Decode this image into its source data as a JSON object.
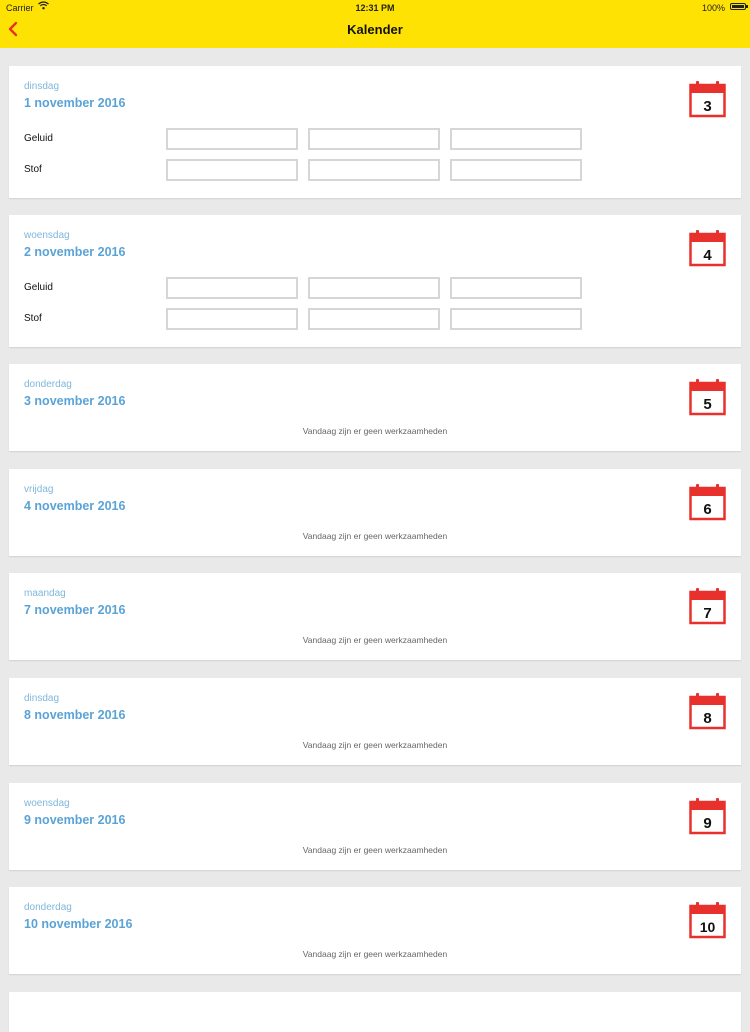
{
  "status_bar": {
    "carrier": "Carrier",
    "time": "12:31 PM",
    "battery": "100%"
  },
  "nav": {
    "title": "Kalender",
    "back": "back"
  },
  "rows": {
    "sound": "Geluid",
    "dust": "Stof"
  },
  "no_work": "Vandaag zijn er geen werkzaamheden",
  "colors": {
    "header_bg": "#fde204",
    "accent_red": "#e8302c",
    "date_blue": "#5aa3d6",
    "weekday_blue": "#7fb7dc"
  },
  "icons": {
    "back": "chevron-left-icon",
    "calendar": "calendar-icon",
    "wifi": "wifi-icon",
    "battery": "battery-icon"
  },
  "days": [
    {
      "weekday": "dinsdag",
      "date": "1 november 2016",
      "icon_day": "3",
      "has_fields": true
    },
    {
      "weekday": "woensdag",
      "date": "2 november 2016",
      "icon_day": "4",
      "has_fields": true
    },
    {
      "weekday": "donderdag",
      "date": "3 november 2016",
      "icon_day": "5",
      "has_fields": false
    },
    {
      "weekday": "vrijdag",
      "date": "4 november 2016",
      "icon_day": "6",
      "has_fields": false
    },
    {
      "weekday": "maandag",
      "date": "7 november 2016",
      "icon_day": "7",
      "has_fields": false
    },
    {
      "weekday": "dinsdag",
      "date": "8 november 2016",
      "icon_day": "8",
      "has_fields": false
    },
    {
      "weekday": "woensdag",
      "date": "9 november 2016",
      "icon_day": "9",
      "has_fields": false
    },
    {
      "weekday": "donderdag",
      "date": "10 november 2016",
      "icon_day": "10",
      "has_fields": false
    }
  ]
}
